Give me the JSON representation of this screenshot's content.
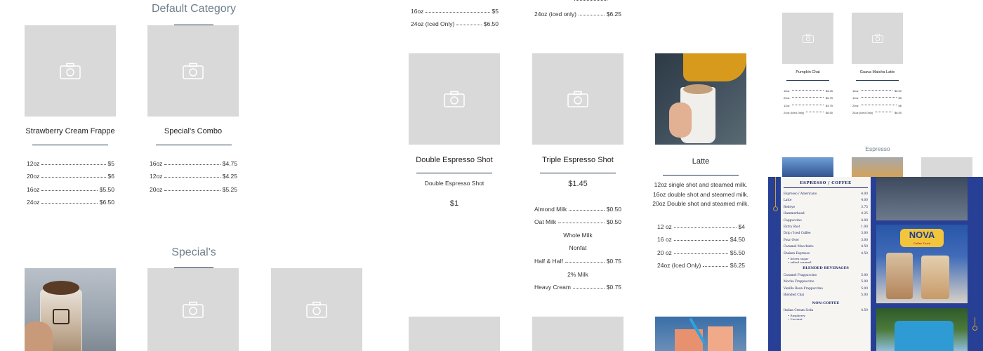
{
  "sections": {
    "default_category": "Default Category",
    "specials": "Special's",
    "espresso": "Espresso"
  },
  "items": {
    "strawberry": {
      "name": "Strawberry Cream Frappe",
      "prices": [
        {
          "size": "12oz",
          "price": "$5"
        },
        {
          "size": "20oz",
          "price": "$6"
        },
        {
          "size": "16oz",
          "price": "$5.50"
        },
        {
          "size": "24oz",
          "price": "$6.50"
        }
      ]
    },
    "specials_combo": {
      "name": "Special's Combo",
      "prices": [
        {
          "size": "16oz",
          "price": "$4.75"
        },
        {
          "size": "12oz",
          "price": "$4.25"
        },
        {
          "size": "20oz",
          "price": "$5.25"
        }
      ]
    },
    "top_partial_a": {
      "prices": [
        {
          "size": "16oz",
          "price": "$5"
        },
        {
          "size": "24oz (Iced Only)",
          "price": "$6.50"
        }
      ]
    },
    "top_partial_b": {
      "prices": [
        {
          "size": "24oz (iced only)",
          "price": "$6.25"
        }
      ]
    },
    "double_espresso": {
      "name": "Double Espresso Shot",
      "description": "Double Espresso Shot",
      "price": "$1"
    },
    "triple_espresso": {
      "name": "Triple Espresso Shot",
      "price": "$1.45",
      "options": [
        {
          "type": "price",
          "label": "Almond Milk",
          "price": "$0.50"
        },
        {
          "type": "price",
          "label": "Oat Milk",
          "price": "$0.50"
        },
        {
          "type": "text",
          "label": "Whole Milk"
        },
        {
          "type": "text",
          "label": "Nonfat"
        },
        {
          "type": "price",
          "label": "Half & Half",
          "price": "$0.75"
        },
        {
          "type": "text",
          "label": "2% Milk"
        },
        {
          "type": "price",
          "label": "Heavy Cream",
          "price": "$0.75"
        }
      ]
    },
    "latte": {
      "name": "Latte",
      "description_lines": [
        "12oz single shot and steamed milk.",
        "16oz double shot and steamed milk.",
        "20oz Double shot and steamed milk."
      ],
      "prices": [
        {
          "size": "12 oz",
          "price": "$4"
        },
        {
          "size": "16 oz",
          "price": "$4.50"
        },
        {
          "size": "20 oz",
          "price": "$5.50"
        },
        {
          "size": "24oz (Iced Only)",
          "price": "$6.25"
        }
      ]
    },
    "pumpkin_chai": {
      "name": "Pumpkin Chai",
      "prices": [
        {
          "size": "16oz",
          "price": "$5.25"
        },
        {
          "size": "20oz",
          "price": "$5.75"
        },
        {
          "size": "12oz",
          "price": "$4.75"
        },
        {
          "size": "24oz (Iced Only)",
          "price": "$6.50"
        }
      ]
    },
    "guava_matcha": {
      "name": "Guava Matcha Latte",
      "prices": [
        {
          "size": "16oz",
          "price": "$5.50"
        },
        {
          "size": "12oz",
          "price": "$5"
        },
        {
          "size": "20oz",
          "price": "$6"
        },
        {
          "size": "24oz (Iced Only)",
          "price": "$6.50"
        }
      ]
    }
  },
  "menu_board": {
    "header": "ESPRESSO / COFFEE",
    "rows": [
      {
        "name": "Espresso / Americano",
        "price": "4.00"
      },
      {
        "name": "Latte",
        "price": "4.00"
      },
      {
        "name": "Redeye",
        "price": "3.75"
      },
      {
        "name": "Hammerhead",
        "price": "4.25"
      },
      {
        "name": "Cappuccino",
        "price": "4.00"
      },
      {
        "name": "Extra Shot",
        "price": "1.00"
      },
      {
        "name": "Drip / Iced Coffee",
        "price": "3.00"
      },
      {
        "name": "Pour Over",
        "price": "3.00"
      },
      {
        "name": "Caramel Macchiato",
        "price": "4.50"
      },
      {
        "name": "Shaken Espresso",
        "price": "4.50"
      }
    ],
    "shaken_bullets": [
      "brown sugar",
      "salted caramel"
    ],
    "blended_header": "BLENDED BEVERAGES",
    "blended_rows": [
      {
        "name": "Caramel Frappuccino",
        "price": "5.00"
      },
      {
        "name": "Mocha Frappuccino",
        "price": "5.00"
      },
      {
        "name": "Vanilla Bean Frappuccino",
        "price": "5.00"
      },
      {
        "name": "Blended Chai",
        "price": "5.00"
      }
    ],
    "noncoffee_header": "NON-COFFEE",
    "noncoffee_rows": [
      {
        "name": "Italian Cream Soda",
        "price": "4.50"
      }
    ],
    "soda_bullets": [
      "Raspberry",
      "Coconut"
    ],
    "nova_sign": "NOVA",
    "nova_sub": "Coffee Truck"
  },
  "colors": {
    "rule": "#1f3550",
    "placeholder": "#d9d9d9",
    "section_title": "#6f7f8c",
    "menu_board": "#273f95"
  }
}
